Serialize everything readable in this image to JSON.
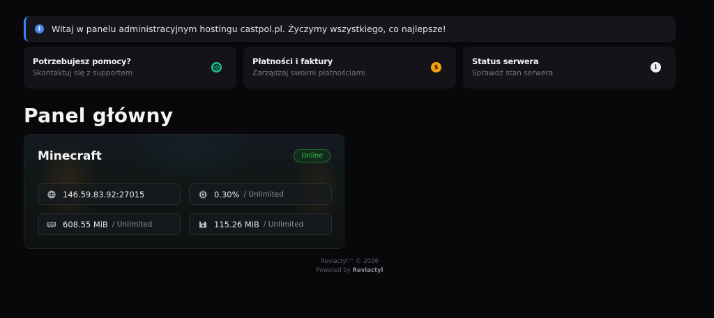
{
  "banner": {
    "icon": "info-circle-icon",
    "text": "Witaj w panelu administracyjnym hostingu castpol.pl. Życzymy wszystkiego, co najlepsze!",
    "accent": "#3b82f6"
  },
  "cards": [
    {
      "title": "Potrzebujesz pomocy?",
      "subtitle": "Skontaktuj się z supportem",
      "icon": "lifebuoy-icon",
      "icon_color": "#1fbf8f"
    },
    {
      "title": "Płatności i faktury",
      "subtitle": "Zarządzaj swoimi płatnościami",
      "icon": "dollar-icon",
      "icon_color": "#f5a20c"
    },
    {
      "title": "Status serwera",
      "subtitle": "Sprawdź stan serwera",
      "icon": "info-icon",
      "icon_color": "#eeeeee"
    }
  ],
  "page_title": "Panel główny",
  "server": {
    "name": "Minecraft",
    "status": "Online",
    "status_color": "#35c24f",
    "address": "146.59.83.92:27015",
    "cpu": "0.30%",
    "cpu_limit": "/ Unlimited",
    "memory": "608.55 MiB",
    "memory_limit": "/ Unlimited",
    "disk": "115.26 MiB",
    "disk_limit": "/ Unlimited"
  },
  "footer": {
    "line1": "Reviactyl™ © 2026",
    "line2_prefix": "Powered by ",
    "line2_brand": "Reviactyl"
  }
}
